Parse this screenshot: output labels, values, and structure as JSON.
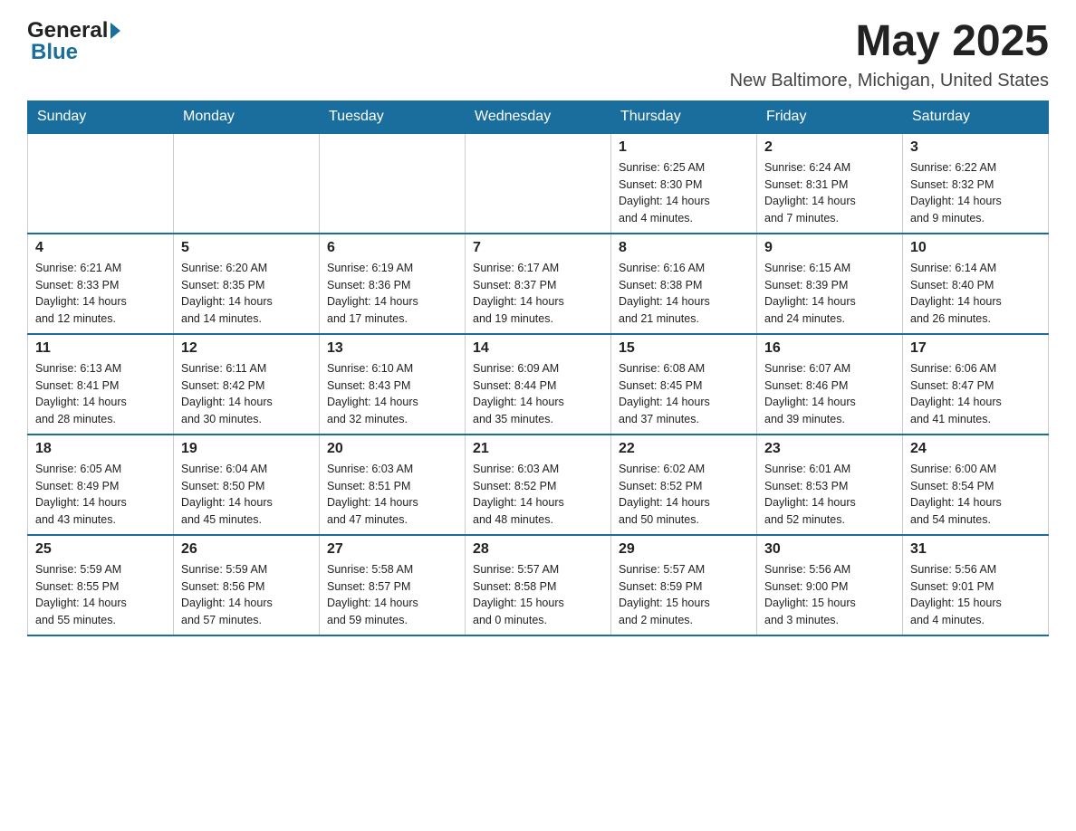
{
  "header": {
    "logo_general": "General",
    "logo_blue": "Blue",
    "month_title": "May 2025",
    "location": "New Baltimore, Michigan, United States"
  },
  "days_of_week": [
    "Sunday",
    "Monday",
    "Tuesday",
    "Wednesday",
    "Thursday",
    "Friday",
    "Saturday"
  ],
  "weeks": [
    {
      "cells": [
        {
          "day": "",
          "info": ""
        },
        {
          "day": "",
          "info": ""
        },
        {
          "day": "",
          "info": ""
        },
        {
          "day": "",
          "info": ""
        },
        {
          "day": "1",
          "info": "Sunrise: 6:25 AM\nSunset: 8:30 PM\nDaylight: 14 hours\nand 4 minutes."
        },
        {
          "day": "2",
          "info": "Sunrise: 6:24 AM\nSunset: 8:31 PM\nDaylight: 14 hours\nand 7 minutes."
        },
        {
          "day": "3",
          "info": "Sunrise: 6:22 AM\nSunset: 8:32 PM\nDaylight: 14 hours\nand 9 minutes."
        }
      ]
    },
    {
      "cells": [
        {
          "day": "4",
          "info": "Sunrise: 6:21 AM\nSunset: 8:33 PM\nDaylight: 14 hours\nand 12 minutes."
        },
        {
          "day": "5",
          "info": "Sunrise: 6:20 AM\nSunset: 8:35 PM\nDaylight: 14 hours\nand 14 minutes."
        },
        {
          "day": "6",
          "info": "Sunrise: 6:19 AM\nSunset: 8:36 PM\nDaylight: 14 hours\nand 17 minutes."
        },
        {
          "day": "7",
          "info": "Sunrise: 6:17 AM\nSunset: 8:37 PM\nDaylight: 14 hours\nand 19 minutes."
        },
        {
          "day": "8",
          "info": "Sunrise: 6:16 AM\nSunset: 8:38 PM\nDaylight: 14 hours\nand 21 minutes."
        },
        {
          "day": "9",
          "info": "Sunrise: 6:15 AM\nSunset: 8:39 PM\nDaylight: 14 hours\nand 24 minutes."
        },
        {
          "day": "10",
          "info": "Sunrise: 6:14 AM\nSunset: 8:40 PM\nDaylight: 14 hours\nand 26 minutes."
        }
      ]
    },
    {
      "cells": [
        {
          "day": "11",
          "info": "Sunrise: 6:13 AM\nSunset: 8:41 PM\nDaylight: 14 hours\nand 28 minutes."
        },
        {
          "day": "12",
          "info": "Sunrise: 6:11 AM\nSunset: 8:42 PM\nDaylight: 14 hours\nand 30 minutes."
        },
        {
          "day": "13",
          "info": "Sunrise: 6:10 AM\nSunset: 8:43 PM\nDaylight: 14 hours\nand 32 minutes."
        },
        {
          "day": "14",
          "info": "Sunrise: 6:09 AM\nSunset: 8:44 PM\nDaylight: 14 hours\nand 35 minutes."
        },
        {
          "day": "15",
          "info": "Sunrise: 6:08 AM\nSunset: 8:45 PM\nDaylight: 14 hours\nand 37 minutes."
        },
        {
          "day": "16",
          "info": "Sunrise: 6:07 AM\nSunset: 8:46 PM\nDaylight: 14 hours\nand 39 minutes."
        },
        {
          "day": "17",
          "info": "Sunrise: 6:06 AM\nSunset: 8:47 PM\nDaylight: 14 hours\nand 41 minutes."
        }
      ]
    },
    {
      "cells": [
        {
          "day": "18",
          "info": "Sunrise: 6:05 AM\nSunset: 8:49 PM\nDaylight: 14 hours\nand 43 minutes."
        },
        {
          "day": "19",
          "info": "Sunrise: 6:04 AM\nSunset: 8:50 PM\nDaylight: 14 hours\nand 45 minutes."
        },
        {
          "day": "20",
          "info": "Sunrise: 6:03 AM\nSunset: 8:51 PM\nDaylight: 14 hours\nand 47 minutes."
        },
        {
          "day": "21",
          "info": "Sunrise: 6:03 AM\nSunset: 8:52 PM\nDaylight: 14 hours\nand 48 minutes."
        },
        {
          "day": "22",
          "info": "Sunrise: 6:02 AM\nSunset: 8:52 PM\nDaylight: 14 hours\nand 50 minutes."
        },
        {
          "day": "23",
          "info": "Sunrise: 6:01 AM\nSunset: 8:53 PM\nDaylight: 14 hours\nand 52 minutes."
        },
        {
          "day": "24",
          "info": "Sunrise: 6:00 AM\nSunset: 8:54 PM\nDaylight: 14 hours\nand 54 minutes."
        }
      ]
    },
    {
      "cells": [
        {
          "day": "25",
          "info": "Sunrise: 5:59 AM\nSunset: 8:55 PM\nDaylight: 14 hours\nand 55 minutes."
        },
        {
          "day": "26",
          "info": "Sunrise: 5:59 AM\nSunset: 8:56 PM\nDaylight: 14 hours\nand 57 minutes."
        },
        {
          "day": "27",
          "info": "Sunrise: 5:58 AM\nSunset: 8:57 PM\nDaylight: 14 hours\nand 59 minutes."
        },
        {
          "day": "28",
          "info": "Sunrise: 5:57 AM\nSunset: 8:58 PM\nDaylight: 15 hours\nand 0 minutes."
        },
        {
          "day": "29",
          "info": "Sunrise: 5:57 AM\nSunset: 8:59 PM\nDaylight: 15 hours\nand 2 minutes."
        },
        {
          "day": "30",
          "info": "Sunrise: 5:56 AM\nSunset: 9:00 PM\nDaylight: 15 hours\nand 3 minutes."
        },
        {
          "day": "31",
          "info": "Sunrise: 5:56 AM\nSunset: 9:01 PM\nDaylight: 15 hours\nand 4 minutes."
        }
      ]
    }
  ]
}
